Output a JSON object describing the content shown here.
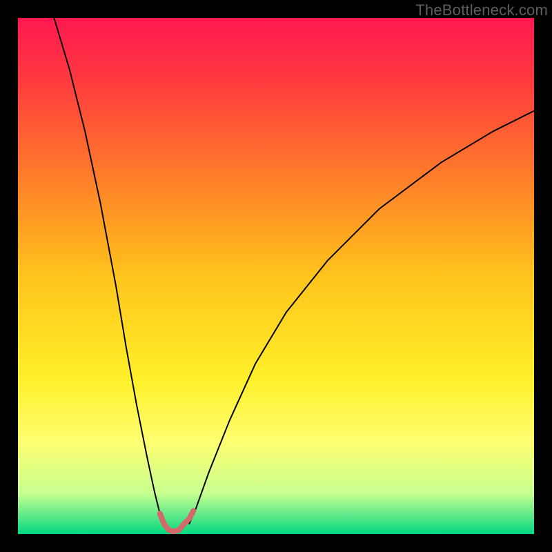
{
  "watermark": "TheBottleneck.com",
  "chart_data": {
    "type": "line",
    "title": "",
    "xlabel": "",
    "ylabel": "",
    "xlim": [
      0,
      100
    ],
    "ylim": [
      0,
      100
    ],
    "grid": false,
    "legend": false,
    "background": {
      "type": "vertical-gradient",
      "stops": [
        {
          "pos": 0.0,
          "color": "#ff1850"
        },
        {
          "pos": 0.12,
          "color": "#ff3a3f"
        },
        {
          "pos": 0.3,
          "color": "#ff7a2a"
        },
        {
          "pos": 0.5,
          "color": "#ffc41c"
        },
        {
          "pos": 0.7,
          "color": "#fff02a"
        },
        {
          "pos": 0.82,
          "color": "#ffff70"
        },
        {
          "pos": 0.92,
          "color": "#c8ff90"
        },
        {
          "pos": 0.97,
          "color": "#50e688"
        },
        {
          "pos": 1.0,
          "color": "#00d880"
        }
      ]
    },
    "series": [
      {
        "name": "left-branch",
        "color": "#000000",
        "width": 2,
        "x": [
          7,
          10,
          13,
          16,
          19,
          21,
          23,
          25,
          26.5,
          27.5,
          28.3
        ],
        "y": [
          100,
          90,
          78,
          64,
          48,
          36,
          25,
          15,
          8,
          4,
          2
        ]
      },
      {
        "name": "right-branch",
        "color": "#000000",
        "width": 2,
        "x": [
          33.2,
          34.5,
          37,
          41,
          46,
          52,
          60,
          70,
          82,
          92,
          100
        ],
        "y": [
          2,
          5,
          12,
          22,
          33,
          43,
          53,
          63,
          72,
          78,
          82
        ]
      },
      {
        "name": "valley-highlight",
        "color": "#d36a6a",
        "width": 8,
        "x": [
          27.5,
          28.3,
          29.2,
          30.2,
          31.2,
          32.2,
          33.2,
          34.0
        ],
        "y": [
          4.0,
          2.0,
          0.8,
          0.5,
          0.8,
          2.0,
          3.0,
          4.5
        ]
      }
    ]
  }
}
